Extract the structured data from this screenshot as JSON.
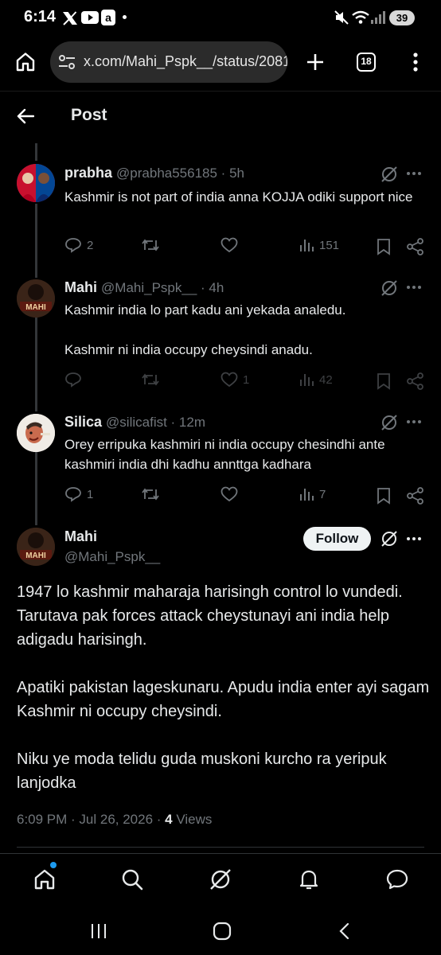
{
  "status_bar": {
    "time": "6:14",
    "battery": "39"
  },
  "browser": {
    "url": "x.com/Mahi_Pspk__/status/2081",
    "tab_count": "18"
  },
  "header": {
    "title": "Post"
  },
  "replies": [
    {
      "name": "prabha",
      "handle": "@prabha556185",
      "time": "5h",
      "text": "Kashmir is not part of india anna KOJJA odiki support nice",
      "replies": "2",
      "reposts": "",
      "likes": "",
      "views": "151"
    },
    {
      "name": "Mahi",
      "handle": "@Mahi_Pspk__",
      "time": "4h",
      "text_lines": [
        "Kashmir india lo part kadu ani yekada analedu.",
        "Kashmir ni india occupy cheysindi anadu."
      ],
      "replies": "",
      "reposts": "",
      "likes": "1",
      "views": "42"
    },
    {
      "name": "Silica",
      "handle": "@silicafist",
      "time": "12m",
      "text": "Orey erripuka kashmiri ni india occupy chesindhi ante kashmiri india dhi kadhu annttga kadhara",
      "replies": "1",
      "reposts": "",
      "likes": "",
      "views": "7"
    }
  ],
  "main_post": {
    "name": "Mahi",
    "handle": "@Mahi_Pspk__",
    "follow_label": "Follow",
    "paragraphs": [
      "1947 lo kashmir maharaja harisingh control lo vundedi. Tarutava pak forces attack cheystunayi ani india help adigadu harisingh.",
      "Apatiki pakistan lageskunaru. Apudu india enter ayi sagam Kashmir ni occupy cheysindi.",
      "Niku ye moda telidu guda muskoni kurcho ra yeripuk lanjodka"
    ],
    "timestamp": "6:09 PM · Jul 26, 2026 · ",
    "views_count": "4",
    "views_label": " Views"
  },
  "colors": {
    "background": "#000000",
    "text": "#e7e9ea",
    "muted": "#71767b",
    "accent": "#1d9bf0"
  }
}
